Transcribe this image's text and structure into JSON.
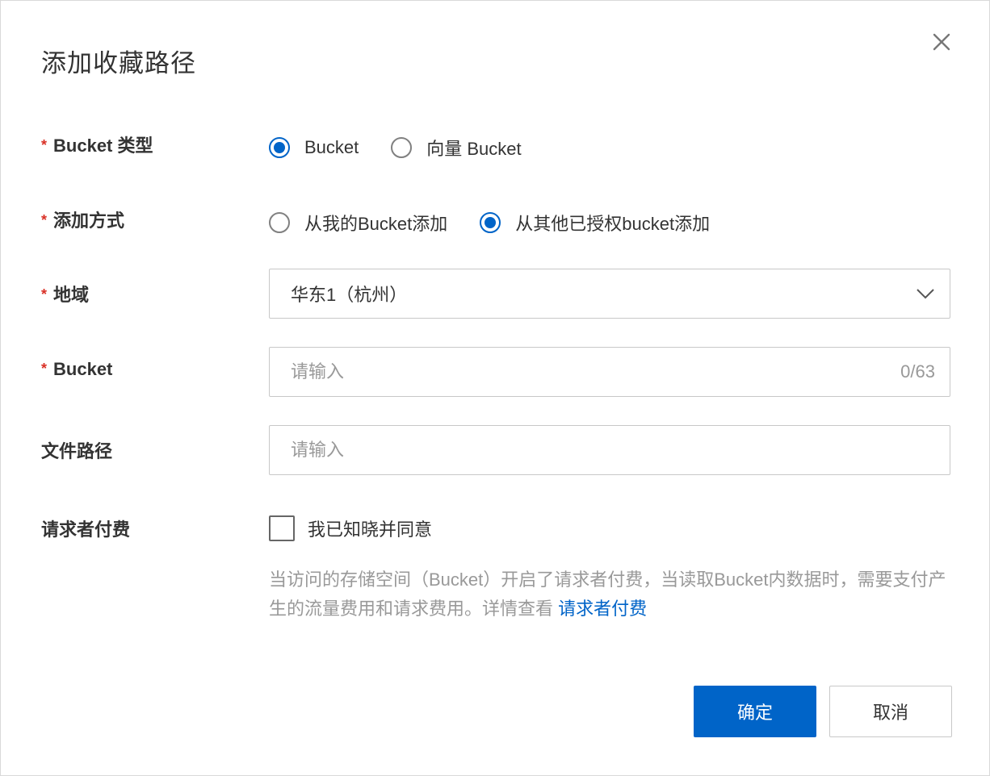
{
  "dialog": {
    "title": "添加收藏路径",
    "close_icon": "close-icon"
  },
  "form": {
    "required_mark": "*",
    "bucket_type": {
      "label": "Bucket 类型",
      "options": [
        {
          "label": "Bucket",
          "checked": true
        },
        {
          "label": "向量 Bucket",
          "checked": false
        }
      ]
    },
    "add_method": {
      "label": "添加方式",
      "options": [
        {
          "label": "从我的Bucket添加",
          "checked": false
        },
        {
          "label": "从其他已授权bucket添加",
          "checked": true
        }
      ]
    },
    "region": {
      "label": "地域",
      "value": "华东1（杭州）",
      "icon": "chevron-down-icon"
    },
    "bucket": {
      "label": "Bucket",
      "placeholder": "请输入",
      "counter": "0/63"
    },
    "file_path": {
      "label": "文件路径",
      "placeholder": "请输入"
    },
    "requester_pays": {
      "label": "请求者付费",
      "checkbox_label": "我已知晓并同意",
      "checked": false,
      "help_text": "当访问的存储空间（Bucket）开启了请求者付费，当读取Bucket内数据时，需要支付产生的流量费用和请求费用。详情查看 ",
      "help_link": "请求者付费"
    }
  },
  "footer": {
    "confirm_label": "确定",
    "cancel_label": "取消"
  },
  "colors": {
    "primary": "#0064c8",
    "required": "#d93026",
    "muted_text": "#999999"
  }
}
